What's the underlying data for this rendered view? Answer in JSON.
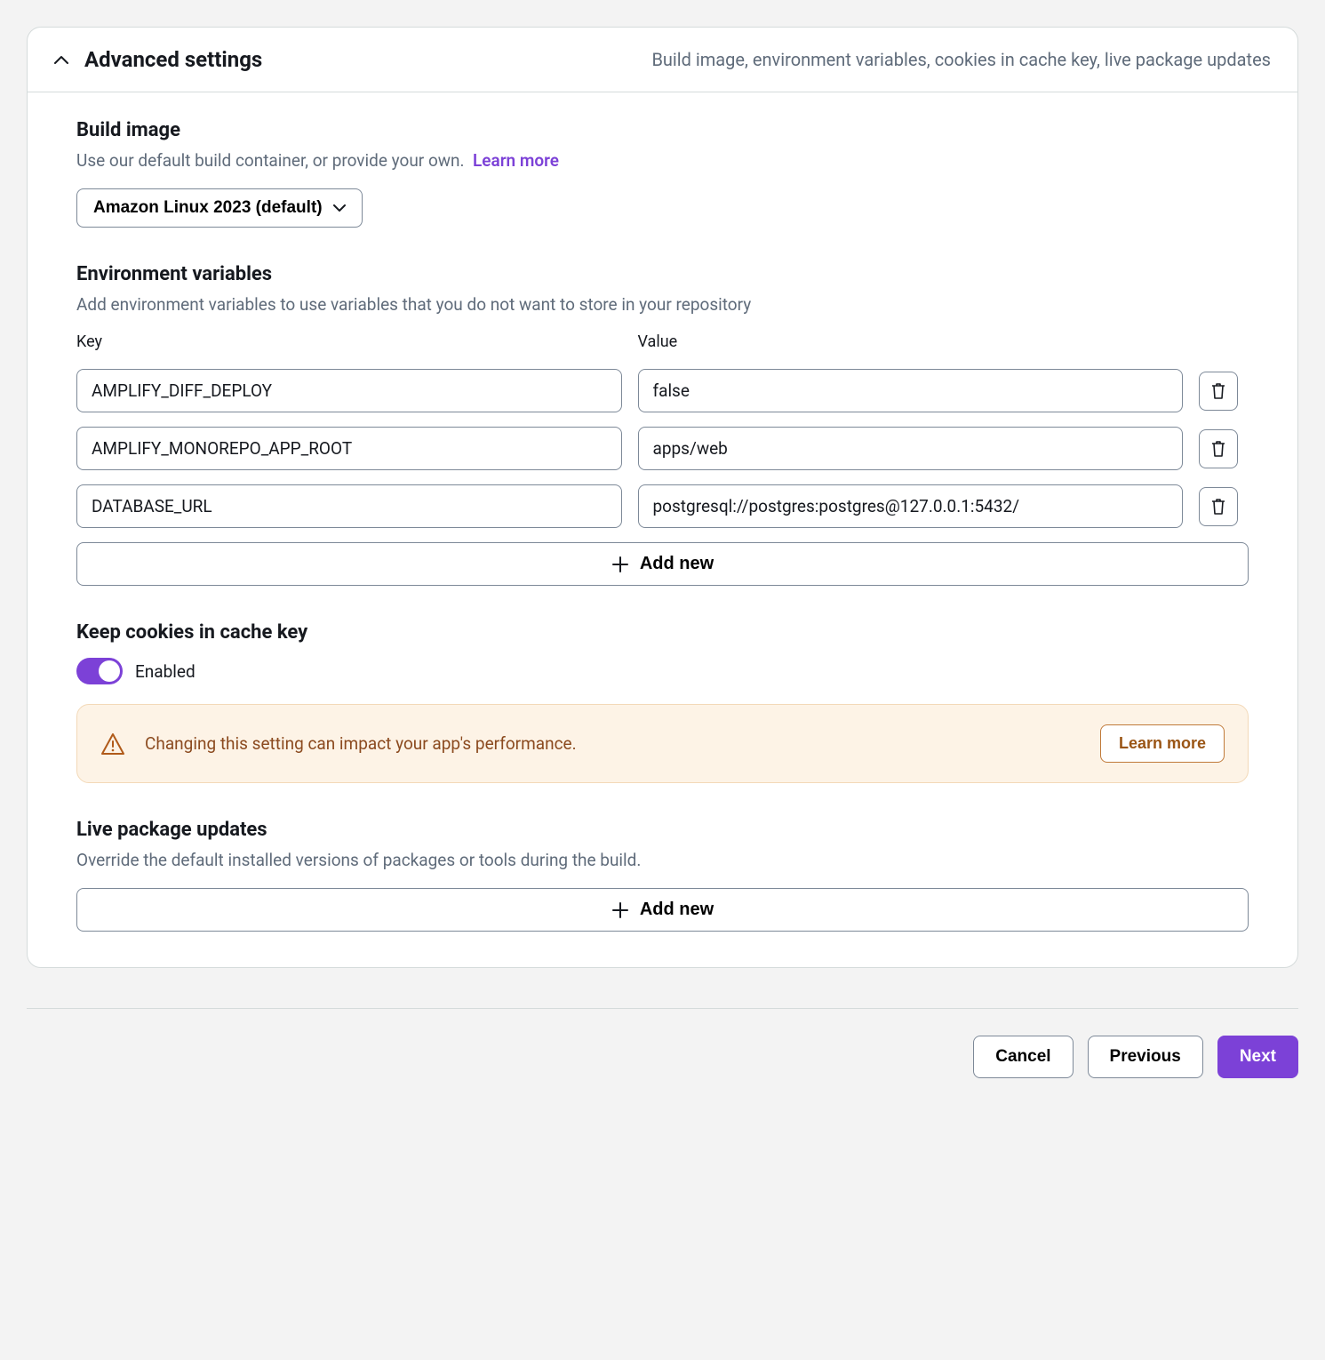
{
  "header": {
    "title": "Advanced settings",
    "subtitle": "Build image, environment variables, cookies in cache key, live package updates"
  },
  "build_image": {
    "title": "Build image",
    "desc": "Use our default build container, or provide your own.",
    "learn_more": "Learn more",
    "selected": "Amazon Linux 2023 (default)"
  },
  "env_vars": {
    "title": "Environment variables",
    "desc": "Add environment variables to use variables that you do not want to store in your repository",
    "key_label": "Key",
    "value_label": "Value",
    "rows": [
      {
        "key": "AMPLIFY_DIFF_DEPLOY",
        "value": "false"
      },
      {
        "key": "AMPLIFY_MONOREPO_APP_ROOT",
        "value": "apps/web"
      },
      {
        "key": "DATABASE_URL",
        "value": "postgresql://postgres:postgres@127.0.0.1:5432/"
      }
    ],
    "add_new": "Add new"
  },
  "cookies": {
    "title": "Keep cookies in cache key",
    "toggle_label": "Enabled",
    "alert_text": "Changing this setting can impact your app's performance.",
    "alert_button": "Learn more"
  },
  "live_pkg": {
    "title": "Live package updates",
    "desc": "Override the default installed versions of packages or tools during the build.",
    "add_new": "Add new"
  },
  "footer": {
    "cancel": "Cancel",
    "previous": "Previous",
    "next": "Next"
  }
}
